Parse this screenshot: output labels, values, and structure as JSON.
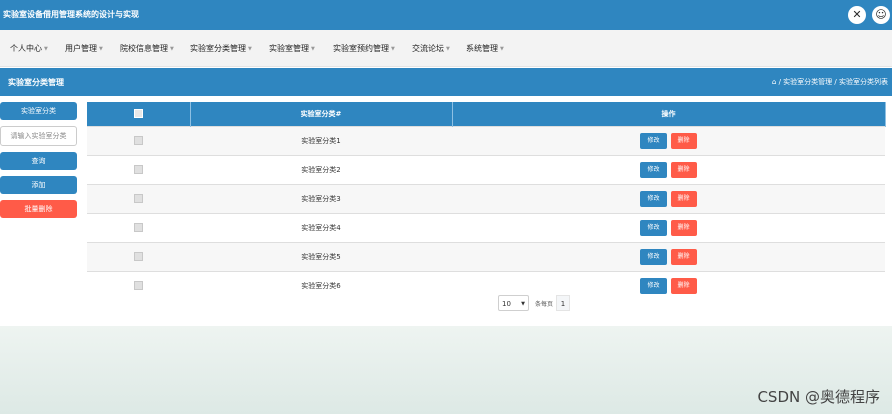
{
  "app": {
    "title": "实验室设备借用管理系统的设计与实现"
  },
  "header_icons": [
    "close-circle-icon",
    "user-circle-icon"
  ],
  "nav": {
    "items": [
      {
        "label": "个人中心"
      },
      {
        "label": "用户管理"
      },
      {
        "label": "院校信息管理"
      },
      {
        "label": "实验室分类管理"
      },
      {
        "label": "实验室管理"
      },
      {
        "label": "实验室预约管理"
      },
      {
        "label": "交流论坛"
      },
      {
        "label": "系统管理"
      }
    ]
  },
  "page": {
    "title": "实验室分类管理",
    "breadcrumb": "/ 实验室分类管理 / 实验室分类列表"
  },
  "search": {
    "field_label": "实验室分类",
    "placeholder": "请输入实验室分类",
    "search_label": "查询",
    "add_label": "添加",
    "batch_delete_label": "批量删除"
  },
  "table": {
    "headers": {
      "name": "实验室分类#",
      "actions": "操作"
    },
    "rows": [
      {
        "name": "实验室分类1"
      },
      {
        "name": "实验室分类2"
      },
      {
        "name": "实验室分类3"
      },
      {
        "name": "实验室分类4"
      },
      {
        "name": "实验室分类5"
      },
      {
        "name": "实验室分类6"
      }
    ],
    "edit_label": "修改",
    "delete_label": "删除"
  },
  "pagination": {
    "page_size": "10",
    "per_page_label": "条每页",
    "current_page": "1"
  },
  "colors": {
    "primary": "#2f86c0",
    "danger": "#ff5b48"
  },
  "watermark": "CSDN @奥德程序"
}
